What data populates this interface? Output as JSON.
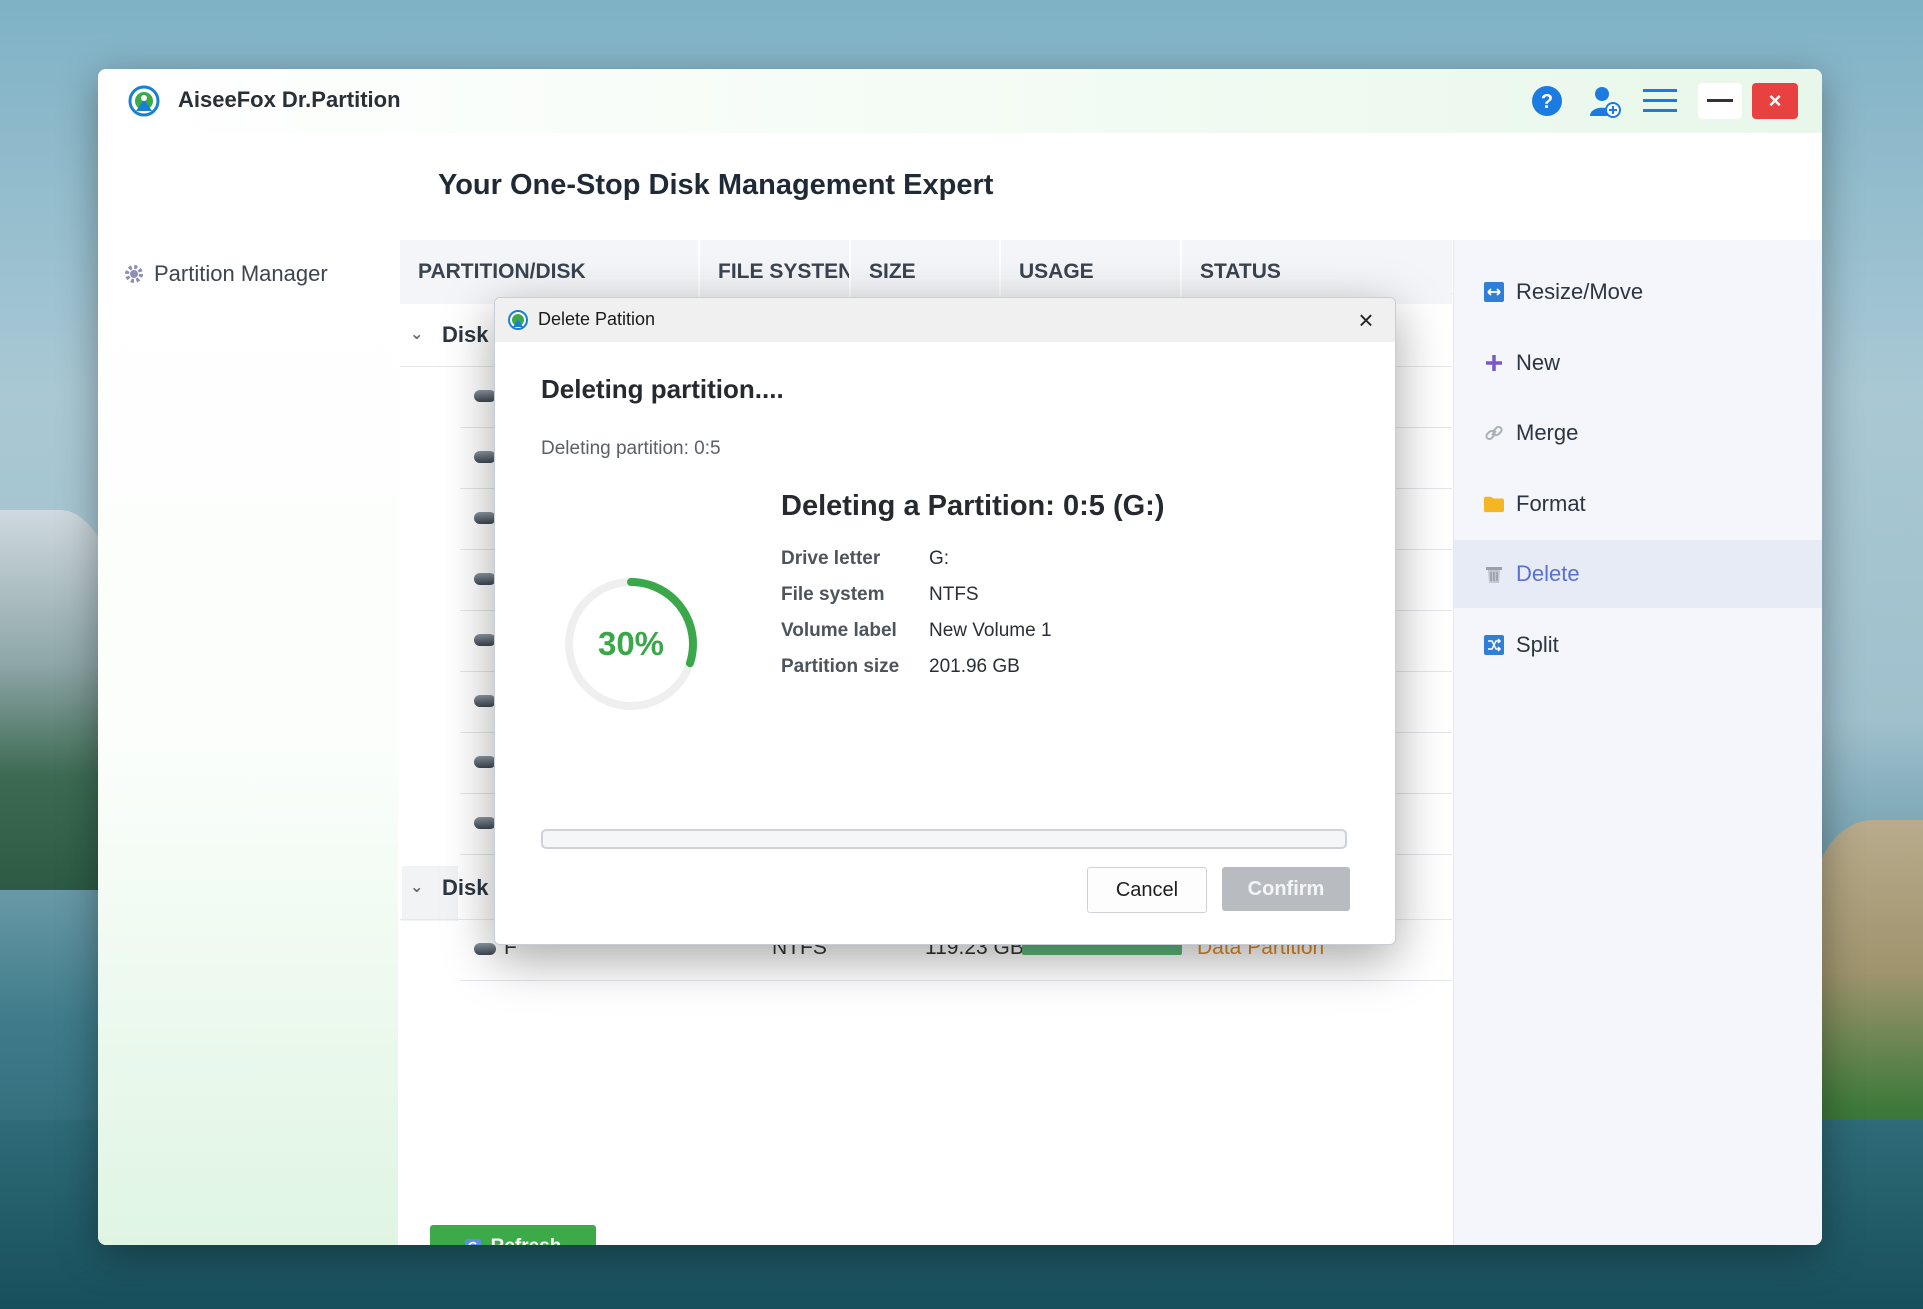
{
  "app": {
    "title": "AiseeFox Dr.Partition",
    "brand_color": "#3daa4a",
    "accent_color": "#5b6fd6"
  },
  "titlebar": {
    "help_icon": "question-circle-icon",
    "user_icon": "user-add-icon",
    "menu_icon": "hamburger-menu-icon",
    "minimize_icon": "minimize-icon",
    "close_label": "×"
  },
  "sidebar": {
    "items": [
      {
        "label": "Partition Manager",
        "icon": "gear-icon"
      }
    ]
  },
  "main": {
    "title": "Your One-Stop Disk Management Expert",
    "table": {
      "columns": [
        "PARTITION/DISK",
        "FILE SYSTEN",
        "SIZE",
        "USAGE",
        "STATUS"
      ],
      "disks": [
        {
          "label": "Disk"
        },
        {
          "label": "Disk"
        }
      ],
      "visible_rows": [
        {
          "name": "F",
          "file_system": "NTFS",
          "size": "119.23 GB",
          "status": "Data Partition"
        }
      ]
    },
    "refresh_label": "Refresh"
  },
  "right_panel": {
    "items": [
      {
        "label": "Resize/Move",
        "icon": "resize-icon",
        "active": false
      },
      {
        "label": "New",
        "icon": "plus-icon",
        "active": false
      },
      {
        "label": "Merge",
        "icon": "link-icon",
        "active": false
      },
      {
        "label": "Format",
        "icon": "folder-icon",
        "active": false
      },
      {
        "label": "Delete",
        "icon": "trash-icon",
        "active": true
      },
      {
        "label": "Split",
        "icon": "split-icon",
        "active": false
      }
    ]
  },
  "dialog": {
    "title": "Delete Patition",
    "close_label": "×",
    "heading": "Deleting partition....",
    "subtext": "Deleting partition: 0:5",
    "progress_percent_label": "30%",
    "progress_value": 0.3,
    "info_title": "Deleting a Partition: 0:5 (G:)",
    "info": [
      {
        "key": "Drive letter",
        "value": "G:"
      },
      {
        "key": "File system",
        "value": "NTFS"
      },
      {
        "key": "Volume label",
        "value": "New Volume 1"
      },
      {
        "key": "Partition size",
        "value": "201.96 GB"
      }
    ],
    "bar_progress": 0.0,
    "cancel_label": "Cancel",
    "confirm_label": "Confirm"
  }
}
